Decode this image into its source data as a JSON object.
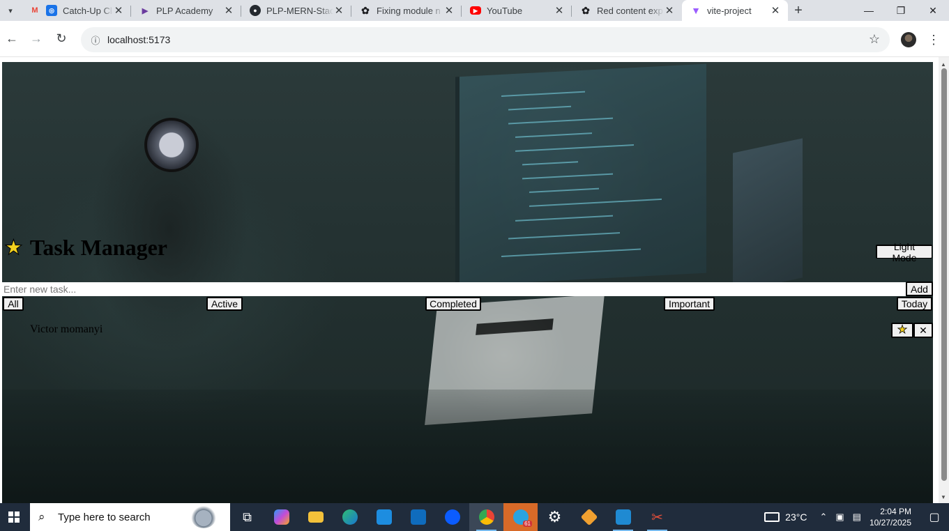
{
  "browser": {
    "tabs": [
      {
        "title": "Catch-Up Cla",
        "icon": "gmail-icon",
        "active": false
      },
      {
        "title": "PLP Academy",
        "icon": "plp-icon",
        "active": false
      },
      {
        "title": "PLP-MERN-Stack",
        "icon": "github-icon",
        "active": false
      },
      {
        "title": "Fixing module n",
        "icon": "chatgpt-icon",
        "active": false
      },
      {
        "title": "YouTube",
        "icon": "youtube-icon",
        "active": false
      },
      {
        "title": "Red content exp",
        "icon": "chatgpt-icon",
        "active": false
      },
      {
        "title": "vite-project",
        "icon": "vite-icon",
        "active": true
      }
    ],
    "url": "localhost:5173"
  },
  "app": {
    "title": "Task Manager",
    "title_icon": "★",
    "theme_toggle_label": "Light Mode",
    "new_task_placeholder": "Enter new task...",
    "new_task_value": "",
    "add_label": "Add",
    "filters": [
      "All",
      "Active",
      "Completed",
      "Important",
      "Today"
    ],
    "tasks": [
      {
        "text": "Victor momanyi",
        "important_icon": "★",
        "delete_icon": "✕"
      }
    ]
  },
  "taskbar": {
    "search_placeholder": "Type here to search",
    "weather": "23°C",
    "time": "2:04 PM",
    "date": "10/27/2025",
    "telegram_badge": "61"
  },
  "colors": {
    "star": "#f4d21f",
    "taskbar": "#202c3c",
    "tab_strip": "#dee1e6"
  }
}
